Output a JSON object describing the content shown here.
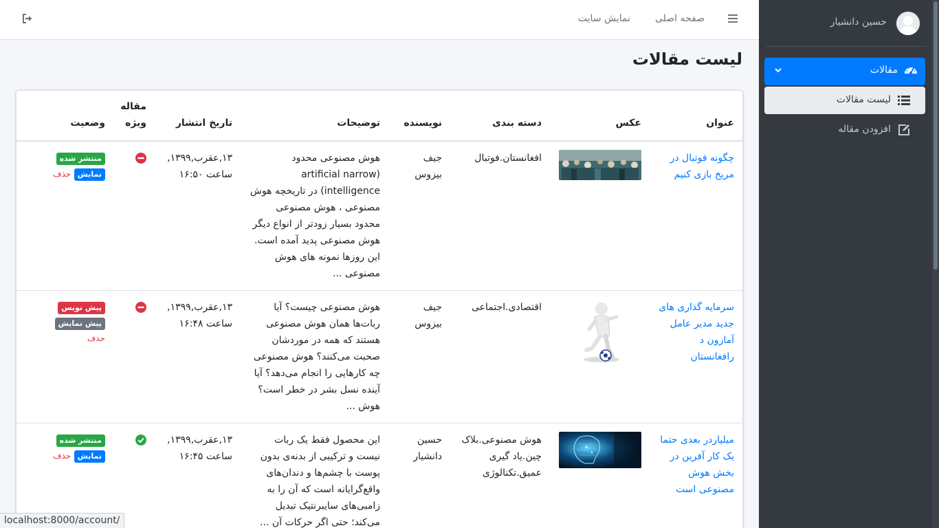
{
  "sidebar": {
    "user_name": "حسین دانشیار",
    "menu": {
      "label": "مقالات",
      "icon": "tachometer-icon",
      "items": [
        {
          "label": "لیست مقالات",
          "icon": "list-icon",
          "active": true
        },
        {
          "label": "افزودن مقاله",
          "icon": "edit-icon",
          "active": false
        }
      ]
    }
  },
  "topbar": {
    "home_label": "صفحه اصلی",
    "site_label": "نمایش سایت",
    "menu_icon": "hamburger-icon",
    "logout_icon": "sign-out-icon"
  },
  "page": {
    "title": "لیست مقالات"
  },
  "table": {
    "headers": {
      "title": "عنوان",
      "image": "عکس",
      "category": "دسته بندی",
      "author": "نویسنده",
      "description": "توضیحات",
      "publish_date": "تاریخ انتشار",
      "special": "مقاله ویژه",
      "status": "وضعیت"
    },
    "rows": [
      {
        "title": "چگونه فوتبال در مریخ بازی کنیم",
        "category": "افغانستان.فوتبال",
        "author": "جیف بیزوس",
        "description": "هوش مصنوعی محدود (artificial narrow intelligence) در تاریخچه هوش مصنوعی ، هوش مصنوعی محدود بسیار زودتر از انواع دیگر هوش مصنوعی پدید آمده است. این روزها نمونه های هوش مصنوعی ...",
        "publish_date": "۱۳,عقرب,۱۳۹۹, ساعت ۱۶:۵۰",
        "special": false,
        "special_icon": "minus-circle-icon",
        "status_badge": "منتشر شده",
        "status_color": "#28a745",
        "action_badge": "نمایش",
        "action_color": "#007bff",
        "delete_label": "حذف"
      },
      {
        "title": "سرمایه گذاری های جدید مدیر عامل آمازون د رافغانستان",
        "category": "اقتصادی.اجتماعی",
        "author": "جیف بیزوس",
        "description": "هوش مصنوعی چیست؟ آیا ربات‌ها همان هوش مصنوعی هستند که همه در موردشان صحبت می‌کنند؟ هوش مصنوعی چه کارهایی را انجام می‌دهد؟ آیا آینده نسل بشر در خطر است؟ هوش ...",
        "publish_date": "۱۳,عقرب,۱۳۹۹, ساعت ۱۶:۴۸",
        "special": false,
        "special_icon": "minus-circle-icon",
        "status_badge": "پیش نویس",
        "status_color": "#dc3545",
        "action_badge": "پیش نمایش",
        "action_color": "#6c757d",
        "delete_label": "حذف"
      },
      {
        "title": "میلیاردر بعدی حتما یک کار آفرین در بخش هوش مصنوعی است",
        "category": "هوش مصنوعی.بلاک چین.یاد گیری عمیق.تکنالوژی",
        "author": "حسین دانشیار",
        "description": "این محصول فقط یک ربات نیست و ترکیبی از بدنه‌ی بدون پوست با چشم‌ها و دندان‌های واقع‌گرایانه است که آن را به زامبی‌های سایبرنتیک تبدیل می‌کند؛ حتی اگر حرکات آن ...",
        "publish_date": "۱۳,عقرب,۱۳۹۹, ساعت ۱۶:۴۵",
        "special": true,
        "special_icon": "check-circle-icon",
        "status_badge": "منتشر شده",
        "status_color": "#28a745",
        "action_badge": "نمایش",
        "action_color": "#007bff",
        "delete_label": "حذف"
      }
    ]
  },
  "statusbar": {
    "url": "localhost:8000/account/"
  }
}
